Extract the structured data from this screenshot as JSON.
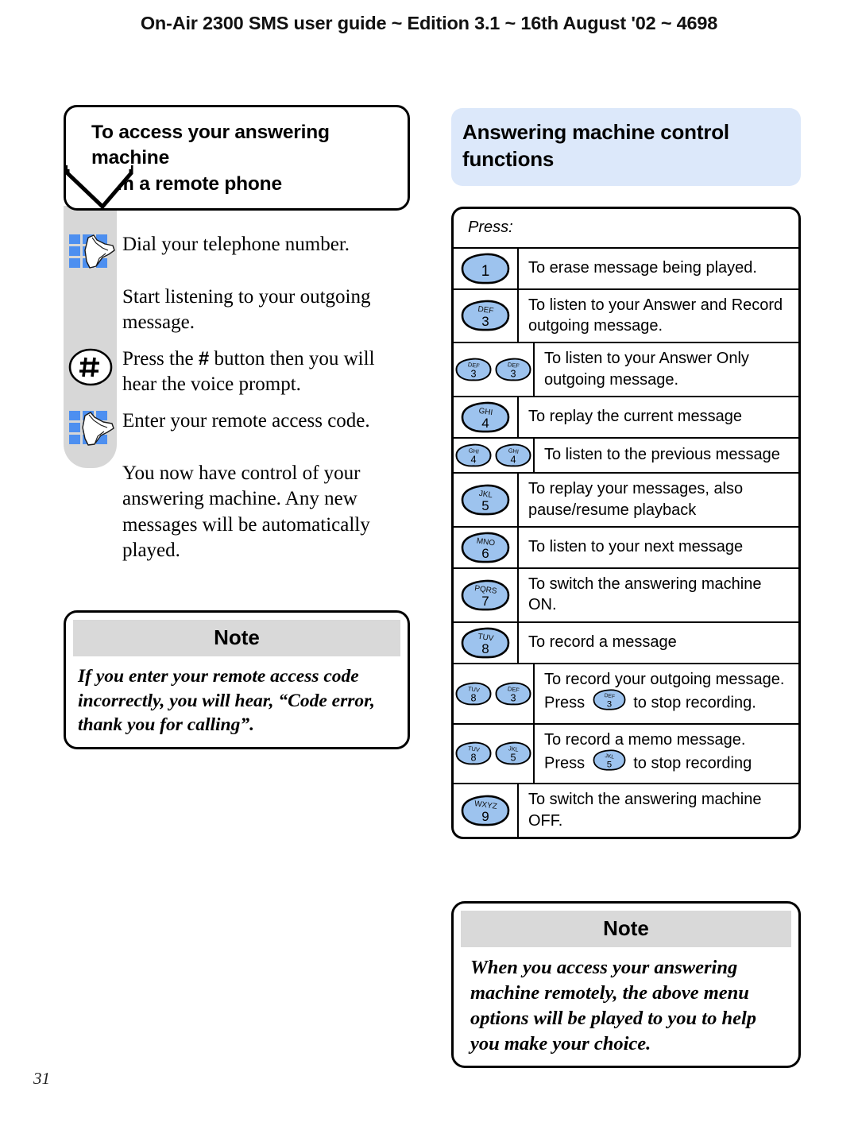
{
  "header": {
    "running_head": "On-Air 2300 SMS user guide ~ Edition 3.1 ~ 16th August '02 ~ 4698"
  },
  "page_number": "31",
  "left_column": {
    "heading": "To access your answering machine from a remote phone",
    "heading_line1": "To access your answering machine",
    "heading_line2": "from a remote phone",
    "steps": [
      {
        "icon": "keypad-hand-icon",
        "text": "Dial your telephone number."
      },
      {
        "icon": "none",
        "text": "Start listening to your outgoing message."
      },
      {
        "icon": "hash-key-icon",
        "text_before": "Press the ",
        "hash": "#",
        "text_after": " button then you will hear the voice prompt."
      },
      {
        "icon": "keypad-hand-icon",
        "text": "Enter your remote access code."
      },
      {
        "icon": "none",
        "text": "You now have control of your answering machine. Any new messages will be automatically played."
      }
    ],
    "note": {
      "title": "Note",
      "body": "If you enter your remote access code incorrectly, you will hear, “Code error, thank you for calling”."
    }
  },
  "right_column": {
    "heading": "Answering machine control functions",
    "heading_line1": "Answering machine control",
    "heading_line2": "functions",
    "table": {
      "header_label": "Press:",
      "rows": [
        {
          "keys": [
            {
              "digit": "1",
              "letters": ""
            }
          ],
          "desc": "To erase message being played."
        },
        {
          "keys": [
            {
              "digit": "3",
              "letters": "DEF"
            }
          ],
          "desc": "To listen to your Answer and Record outgoing message."
        },
        {
          "keys": [
            {
              "digit": "3",
              "letters": "DEF"
            },
            {
              "digit": "3",
              "letters": "DEF"
            }
          ],
          "desc": "To listen to your Answer Only outgoing message."
        },
        {
          "keys": [
            {
              "digit": "4",
              "letters": "GHI"
            }
          ],
          "desc": "To replay the current message"
        },
        {
          "keys": [
            {
              "digit": "4",
              "letters": "GHI"
            },
            {
              "digit": "4",
              "letters": "GHI"
            }
          ],
          "desc": "To listen to the previous message"
        },
        {
          "keys": [
            {
              "digit": "5",
              "letters": "JKL"
            }
          ],
          "desc": "To replay your messages, also pause/resume playback"
        },
        {
          "keys": [
            {
              "digit": "6",
              "letters": "MNO"
            }
          ],
          "desc": "To listen to your next message"
        },
        {
          "keys": [
            {
              "digit": "7",
              "letters": "PQRS"
            }
          ],
          "desc": "To switch the answering machine ON."
        },
        {
          "keys": [
            {
              "digit": "8",
              "letters": "TUV"
            }
          ],
          "desc": "To record a message"
        },
        {
          "keys": [
            {
              "digit": "8",
              "letters": "TUV"
            },
            {
              "digit": "3",
              "letters": "DEF"
            }
          ],
          "desc_line1": "To record your outgoing message.",
          "desc_line2_before": "Press ",
          "desc_inline_key": {
            "digit": "3",
            "letters": "DEF"
          },
          "desc_line2_after": " to stop recording."
        },
        {
          "keys": [
            {
              "digit": "8",
              "letters": "TUV"
            },
            {
              "digit": "5",
              "letters": "JKL"
            }
          ],
          "desc_line1": "To record a memo message.",
          "desc_line2_before": "Press ",
          "desc_inline_key": {
            "digit": "5",
            "letters": "JKL"
          },
          "desc_line2_after": " to stop recording"
        },
        {
          "keys": [
            {
              "digit": "9",
              "letters": "WXYZ"
            }
          ],
          "desc": "To switch the answering machine OFF."
        }
      ]
    },
    "note": {
      "title": "Note",
      "body": "When you access your answering machine remotely, the above menu options will be played to you to help you make your choice."
    }
  },
  "colors": {
    "heading_blue": "#dce8fa",
    "key_blue": "#9dc3ee",
    "note_gray": "#d9d9d9",
    "strip_gray": "#d7d7d7"
  }
}
